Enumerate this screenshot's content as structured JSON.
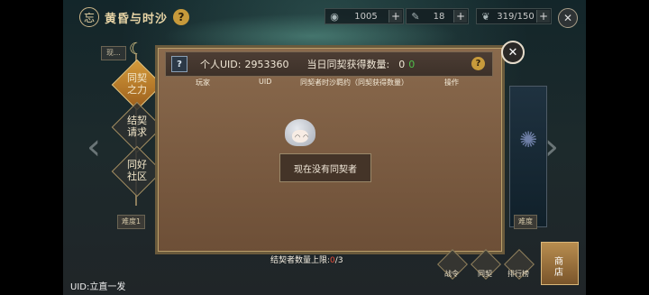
{
  "header": {
    "logo_glyph": "忘",
    "title": "黄昏与时沙",
    "help": "?",
    "resources": [
      {
        "icon": "eye-icon",
        "glyph": "◉",
        "value": "1005",
        "plus": "+"
      },
      {
        "icon": "staff-icon",
        "glyph": "✎",
        "value": "18",
        "plus": "+"
      },
      {
        "icon": "feather-icon",
        "glyph": "❦",
        "value": "319/150",
        "plus": "+"
      }
    ],
    "close": "✕"
  },
  "side_menu": {
    "moon": "☾",
    "tag": "现...",
    "items": [
      {
        "label_line1": "同契",
        "label_line2": "之力",
        "active": true
      },
      {
        "label_line1": "结契",
        "label_line2": "请求",
        "active": false
      },
      {
        "label_line1": "同好",
        "label_line2": "社区",
        "active": false
      }
    ],
    "difficulty_left": "难度1",
    "difficulty_right": "难度"
  },
  "panel": {
    "help_box": "?",
    "uid_label": "个人UID:",
    "uid_value": "2953360",
    "count_label": "当日同契获得数量:",
    "count_value": "0",
    "count_green": "0",
    "help": "?",
    "columns": [
      "玩家",
      "UID",
      "同契者时沙羁约（同契获得数量）",
      "操作"
    ],
    "empty_message": "现在没有同契者",
    "limit_label": "结契者数量上限:",
    "limit_current": "0",
    "limit_max": "/3",
    "close": "✕"
  },
  "footer": {
    "uid_text": "UID:立直一发",
    "buttons": [
      "战令",
      "同契",
      "排行榜"
    ],
    "shop_label_line1": "商",
    "shop_label_line2": "店"
  },
  "arrows": {
    "left": "‹",
    "right": "›"
  }
}
